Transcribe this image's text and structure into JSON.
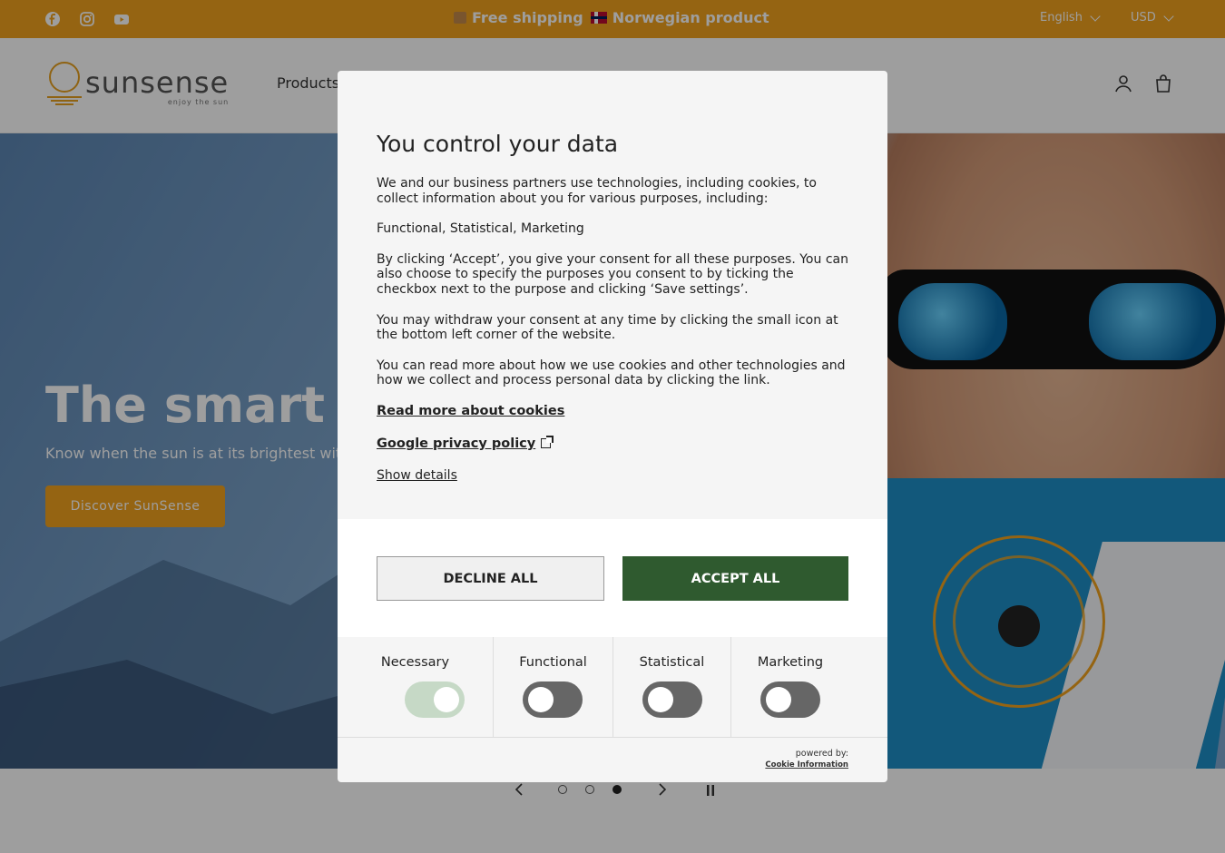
{
  "announcement": {
    "shipping": "Free shipping",
    "product": "Norwegian product",
    "language": "English",
    "currency": "USD"
  },
  "social_icons": [
    "facebook-icon",
    "instagram-icon",
    "youtube-icon"
  ],
  "header": {
    "logo_text": "sunsense",
    "logo_tagline": "enjoy the sun",
    "nav_products": "Products"
  },
  "hero": {
    "title": "The smart opt",
    "subtitle": "Know when the sun is at its brightest with",
    "cta": "Discover SunSense"
  },
  "modal": {
    "title": "You control your data",
    "paragraphs": [
      "We and our business partners use technologies, including cookies, to collect information about you for various purposes, including:",
      "Functional, Statistical, Marketing",
      "By clicking ‘Accept’, you give your consent for all these purposes. You can also choose to specify the purposes you consent to by ticking the checkbox next to the purpose and clicking ‘Save settings’.",
      "You may withdraw your consent at any time by clicking the small icon at the bottom left corner of the website.",
      "You can read more about how we use cookies and other technologies and how we collect and process personal data by clicking the link."
    ],
    "read_more_link": "Read more about cookies",
    "google_link": "Google privacy policy",
    "show_details": "Show details",
    "decline": "DECLINE ALL",
    "accept": "ACCEPT ALL",
    "categories": [
      {
        "label": "Necessary",
        "enabled": true
      },
      {
        "label": "Functional",
        "enabled": false
      },
      {
        "label": "Statistical",
        "enabled": false
      },
      {
        "label": "Marketing",
        "enabled": false
      }
    ],
    "powered_by": "powered by:",
    "powered_brand": "Cookie Information"
  },
  "slider": {
    "active_index": 2,
    "count": 3
  },
  "colors": {
    "accent": "#f0a21e",
    "accept_green": "#2f5a2f"
  }
}
